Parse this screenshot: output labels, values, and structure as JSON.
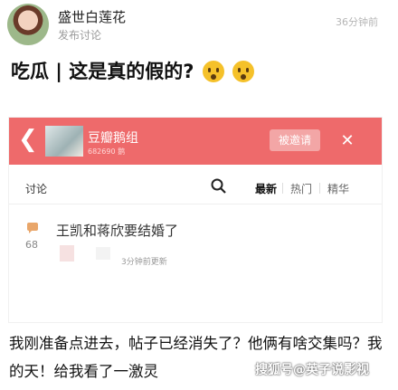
{
  "post": {
    "author": "盛世白莲花",
    "subtitle": "发布讨论",
    "time": "36分钟前",
    "title": "吃瓜 | 这是真的假的?",
    "emoji_icon": "astonished-face-emoji",
    "body": "我刚准备点进去，帖子已经消失了？他俩有啥交集吗？我的天！给我看了一激灵",
    "watermark": "搜狐号@英子说影视"
  },
  "embedded_screenshot": {
    "header_color": "#ee6a6b",
    "group_name": "豆瓣鹅组",
    "group_count": "682690 鹅",
    "invited_button": "被邀请",
    "section_label": "讨论",
    "tabs": [
      "最新",
      "热门",
      "精华"
    ],
    "active_tab": "最新",
    "thread": {
      "title": "王凯和蒋欣要结婚了",
      "comments": "68",
      "time": "3分钟前更新"
    }
  }
}
